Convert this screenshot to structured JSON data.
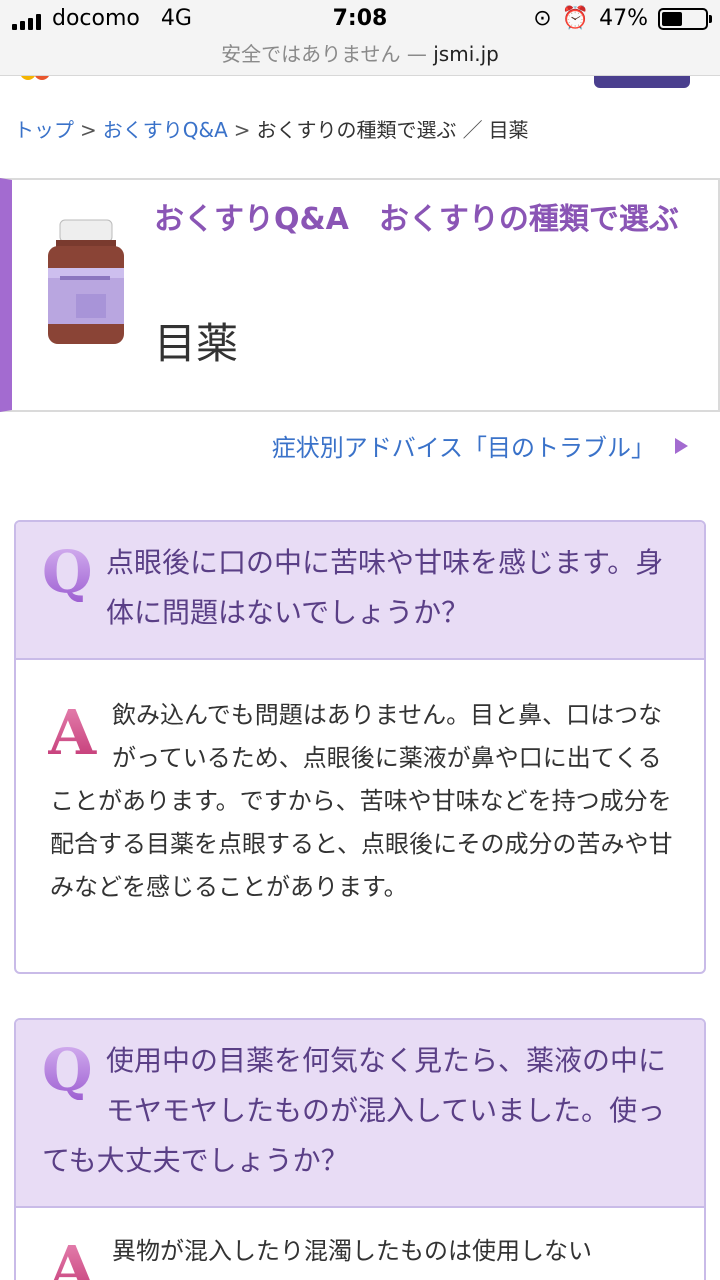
{
  "status_bar": {
    "carrier": "docomo",
    "network": "4G",
    "time": "7:08",
    "battery_percent_label": "47%",
    "battery_level": 0.47
  },
  "url_bar": {
    "security_text": "安全ではありません —",
    "host": "jsmi.jp"
  },
  "breadcrumb": {
    "items": [
      "トップ",
      "おくすりQ&A",
      "おくすりの種類で選ぶ",
      "目薬"
    ],
    "separators": [
      ">",
      ">",
      "／"
    ]
  },
  "title_box": {
    "category": "おくすりQ&A　おくすりの種類で選ぶ",
    "title": "目薬"
  },
  "symptom_link": {
    "label": "症状別アドバイス「目のトラブル」"
  },
  "qa": [
    {
      "question": "点眼後に口の中に苦味や甘味を感じます。身体に問題はないでしょうか？",
      "answer": "飲み込んでも問題はありません。目と鼻、口はつながっているため、点眼後に薬液が鼻や口に出てくることがあります。ですから、苦味や甘味などを持つ成分を配合する目薬を点眼すると、点眼後にその成分の苦みや甘みなどを感じることがあります。"
    },
    {
      "question": "使用中の目薬を何気なく見たら、薬液の中にモヤモヤしたものが混入していました。使っても大丈夫でしょうか？",
      "answer": "異物が混入したり混濁したものは使用しない"
    }
  ],
  "colors": {
    "accent_purple": "#a36bd0",
    "link_blue": "#3a72c9",
    "question_bg": "#e8dcf5"
  },
  "icons": [
    "signal-icon",
    "orientation-lock-icon",
    "alarm-icon",
    "battery-icon",
    "medicine-bottle-icon",
    "triangle-arrow-icon",
    "q-badge-icon",
    "a-badge-icon"
  ]
}
